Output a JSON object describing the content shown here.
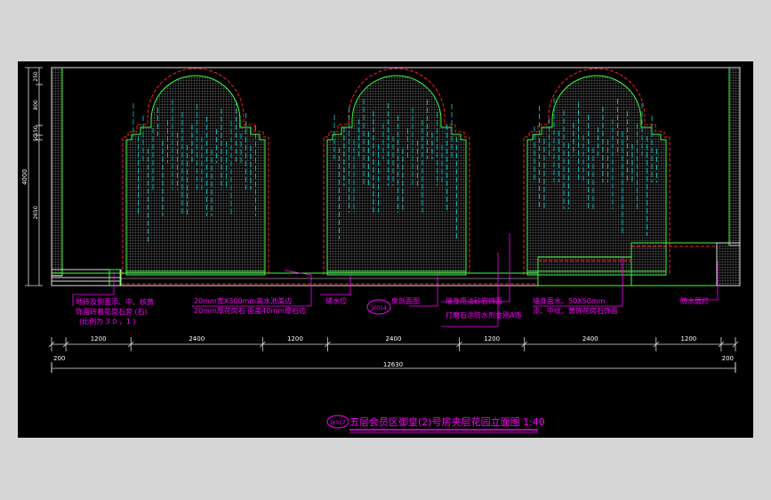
{
  "colors": {
    "background": "#000000",
    "frame": "#d6d6d6",
    "arch_outline": "#ff2020",
    "arch_edge": "#40ff40",
    "mesh": "#c0c0c0",
    "water_lines": "#00e0e0",
    "dimension": "#e0e0e0",
    "annotation": "#ff00ff",
    "title": "#ff00ff"
  },
  "left_dims": {
    "total": "4000",
    "segments": [
      "250",
      "800",
      "150",
      "50",
      "2650"
    ]
  },
  "notes": [
    "地砖及侧面添、中、核黄",
    "饰面砖着花岗石旁 (石)",
    "(比例为 3 0 ，1 )",
    "20mm宽X300mm高水池盖边",
    "20mm厚花岗石 面盖40mm厚石边",
    "储水位",
    "泉剖面图",
    "墙身用油砂岩饰面",
    "打磨石涂防水剂金刚A饰",
    "墙身面水、50X50mm",
    "添、中纹、黄饰花岗石饰面",
    "防水层灯"
  ],
  "callout_ref": "JX014",
  "bottom_dims": {
    "segments": [
      "200",
      "1200",
      "2400",
      "1200",
      "2400",
      "1200",
      "2400",
      "1200",
      "200"
    ],
    "total": "12630"
  },
  "title": {
    "ref": "JX017",
    "text": "五层会员区御皇(2)号房夹层花园立面图  1:40"
  }
}
